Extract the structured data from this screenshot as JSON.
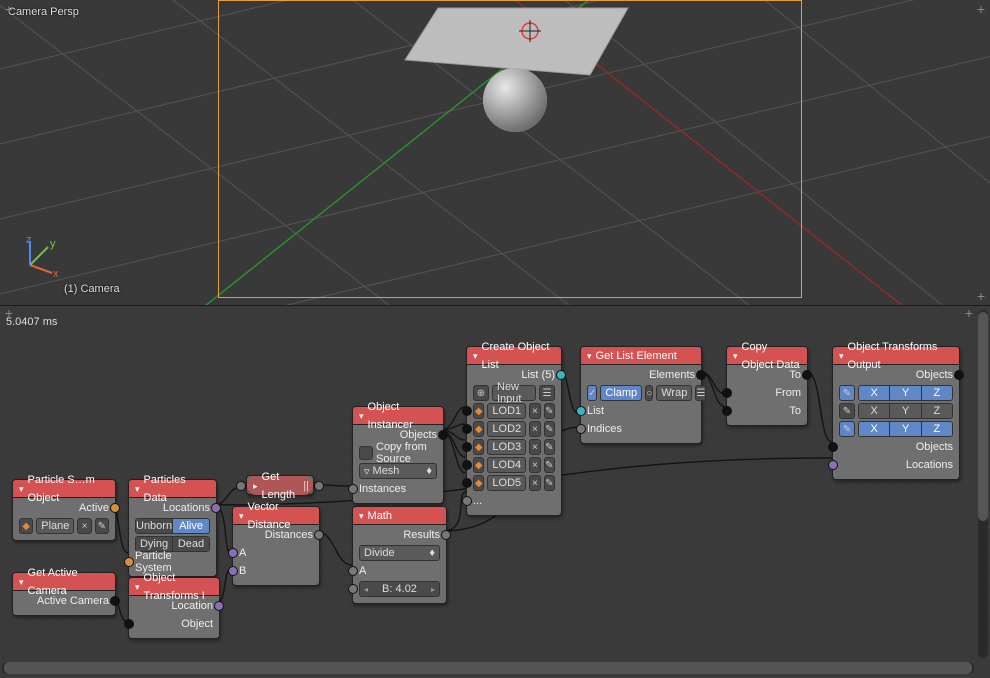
{
  "viewport": {
    "camera_label": "Camera Persp",
    "object_label": "(1) Camera",
    "axes": {
      "x": "x",
      "y": "y",
      "z": "z"
    }
  },
  "node_editor": {
    "timing": "5.0407 ms"
  },
  "nodes": {
    "particle_obj": {
      "title": "Particle S…m Object",
      "out_active": "Active",
      "field_plane": "Plane"
    },
    "get_camera": {
      "title": "Get Active Camera",
      "out": "Active Camera"
    },
    "particles_data": {
      "title": "Particles Data",
      "out_locations": "Locations",
      "seg": [
        "Unborn",
        "Alive",
        "Dying",
        "Dead"
      ],
      "in_ps": "Particle System"
    },
    "obj_transforms_in": {
      "title": "Object Transforms I",
      "out_location": "Location",
      "in_object": "Object"
    },
    "get_length": {
      "title": "Get Length"
    },
    "vector_distance": {
      "title": "Vector Distance",
      "out_distances": "Distances",
      "in_a": "A",
      "in_b": "B"
    },
    "object_instancer": {
      "title": "Object Instancer",
      "out_objects": "Objects",
      "copy_from_source": "Copy from Source",
      "mesh": "Mesh",
      "in_instances": "Instances"
    },
    "math": {
      "title": "Math",
      "out_results": "Results",
      "mode": "Divide",
      "in_a": "A",
      "b_label": "B:",
      "b_value": "4.02"
    },
    "create_list": {
      "title": "Create Object List",
      "list_count": "List (5)",
      "new_input": "New Input",
      "lods": [
        "LOD1",
        "LOD2",
        "LOD3",
        "LOD4",
        "LOD5"
      ],
      "ellipsis": "..."
    },
    "get_list_element": {
      "title": "Get List Element",
      "out_elements": "Elements",
      "clamp": "Clamp",
      "wrap": "Wrap",
      "in_list": "List",
      "in_indices": "Indices"
    },
    "copy_obj_data": {
      "title": "Copy Object Data",
      "out_to": "To",
      "in_from": "From",
      "in_to": "To"
    },
    "obj_transforms_out": {
      "title": "Object Transforms Output",
      "out_objects": "Objects",
      "axes": [
        "X",
        "Y",
        "Z"
      ],
      "in_objects": "Objects",
      "in_locations": "Locations"
    }
  }
}
